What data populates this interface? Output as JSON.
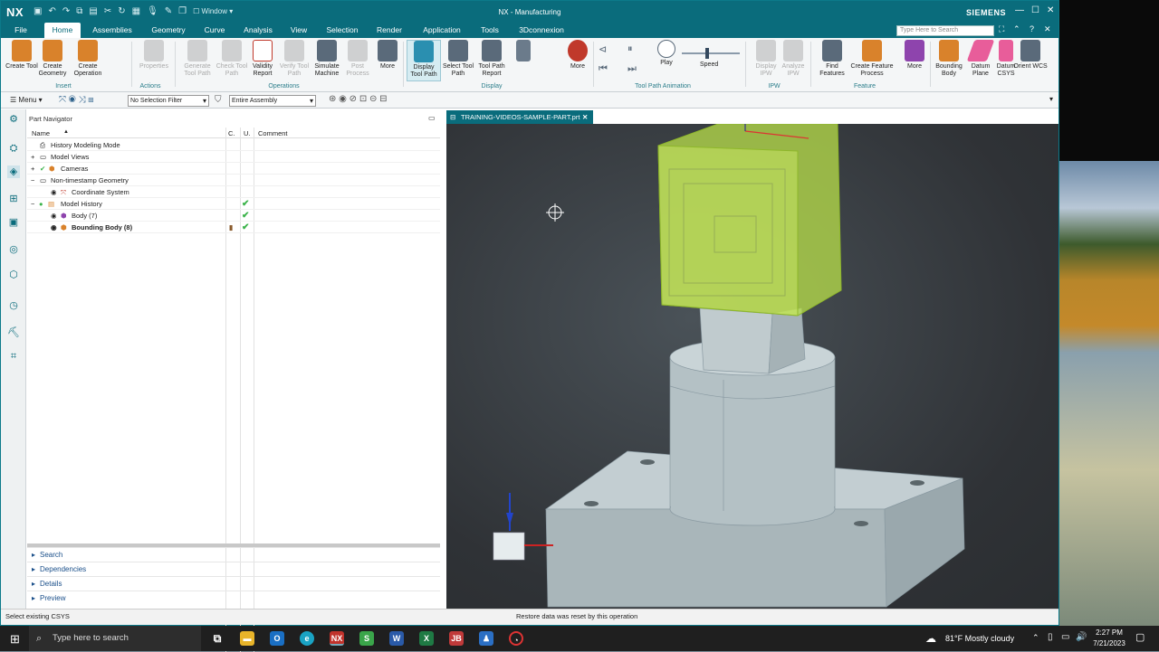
{
  "app": {
    "logo": "NX",
    "window_menu": "Window",
    "title": "NX - Manufacturing",
    "brand": "SIEMENS",
    "search_placeholder": "Type Here to Search"
  },
  "menu_tabs": [
    "File",
    "Home",
    "Assemblies",
    "Geometry",
    "Curve",
    "Analysis",
    "View",
    "Selection",
    "Render",
    "Application",
    "Tools",
    "3Dconnexion"
  ],
  "ribbon": {
    "buttons": [
      {
        "label": "Create Tool",
        "color": "#d9822b",
        "disabled": false
      },
      {
        "label": "Create Geometry",
        "color": "#d9822b",
        "disabled": false
      },
      {
        "label": "Create Operation",
        "color": "#d9822b",
        "disabled": false
      },
      {
        "label": "Properties",
        "color": "#999999",
        "disabled": true
      },
      {
        "label": "Generate Tool Path",
        "color": "#999999",
        "disabled": true
      },
      {
        "label": "Check Tool Path",
        "color": "#999999",
        "disabled": true
      },
      {
        "label": "Validity Report",
        "color": "#c0392b",
        "disabled": false
      },
      {
        "label": "Verify Tool Path",
        "color": "#999999",
        "disabled": true
      },
      {
        "label": "Simulate Machine",
        "color": "#5a6a7a",
        "disabled": false
      },
      {
        "label": "Post Process",
        "color": "#999999",
        "disabled": true
      },
      {
        "label": "More",
        "color": "#5a6a7a",
        "disabled": false
      },
      {
        "label": "Display Tool Path",
        "color": "#2a8fb0",
        "disabled": false
      },
      {
        "label": "Select Tool Path",
        "color": "#5a6a7a",
        "disabled": false
      },
      {
        "label": "Tool Path Report",
        "color": "#5a6a7a",
        "disabled": false
      },
      {
        "label": "More",
        "color": "#c0392b",
        "disabled": false
      },
      {
        "label": "Play",
        "color": "#5a6a7a",
        "disabled": false
      },
      {
        "label": "Speed",
        "color": "#5a6a7a",
        "disabled": false
      },
      {
        "label": "Display IPW",
        "color": "#999999",
        "disabled": true
      },
      {
        "label": "Analyze IPW",
        "color": "#999999",
        "disabled": true
      },
      {
        "label": "Find Features",
        "color": "#5a6a7a",
        "disabled": false
      },
      {
        "label": "Create Feature Process",
        "color": "#d9822b",
        "disabled": false
      },
      {
        "label": "More",
        "color": "#8e44ad",
        "disabled": false
      },
      {
        "label": "Bounding Body",
        "color": "#d9822b",
        "disabled": false
      },
      {
        "label": "Datum Plane",
        "color": "#e85d9a",
        "disabled": false
      },
      {
        "label": "Datum CSYS",
        "color": "#e85d9a",
        "disabled": false
      },
      {
        "label": "Orient WCS",
        "color": "#5a6a7a",
        "disabled": false
      }
    ],
    "groups": [
      "Insert",
      "Actions",
      "Operations",
      "Display",
      "Tool Path Animation",
      "IPW",
      "Feature"
    ]
  },
  "toolbar2": {
    "menu": "Menu",
    "selection_filter": "No Selection Filter",
    "assembly_scope": "Entire Assembly"
  },
  "navigator": {
    "title": "Part Navigator",
    "columns": [
      "Name",
      "C.",
      "U.",
      "Comment"
    ],
    "tree": [
      {
        "label": "History Modeling Mode",
        "indent": 0,
        "check": ""
      },
      {
        "label": "Model Views",
        "indent": 0,
        "check": ""
      },
      {
        "label": "Cameras",
        "indent": 0,
        "check": ""
      },
      {
        "label": "Non-timestamp Geometry",
        "indent": 0,
        "check": ""
      },
      {
        "label": "Coordinate System",
        "indent": 1,
        "check": ""
      },
      {
        "label": "Model History",
        "indent": 0,
        "check": "✔"
      },
      {
        "label": "Body (7)",
        "indent": 1,
        "check": "✔"
      },
      {
        "label": "Bounding Body (8)",
        "indent": 1,
        "check": "✔"
      }
    ],
    "panels": [
      "Search",
      "Dependencies",
      "Details",
      "Preview"
    ]
  },
  "viewport": {
    "tab_title": "TRAINING-VIDEOS-SAMPLE-PART.prt"
  },
  "status": {
    "left": "Select existing CSYS",
    "center": "Restore data was reset by this operation"
  },
  "taskbar": {
    "search_placeholder": "Type here to search",
    "weather": "81°F  Mostly cloudy",
    "time": "2:27 PM",
    "date": "7/21/2023"
  }
}
